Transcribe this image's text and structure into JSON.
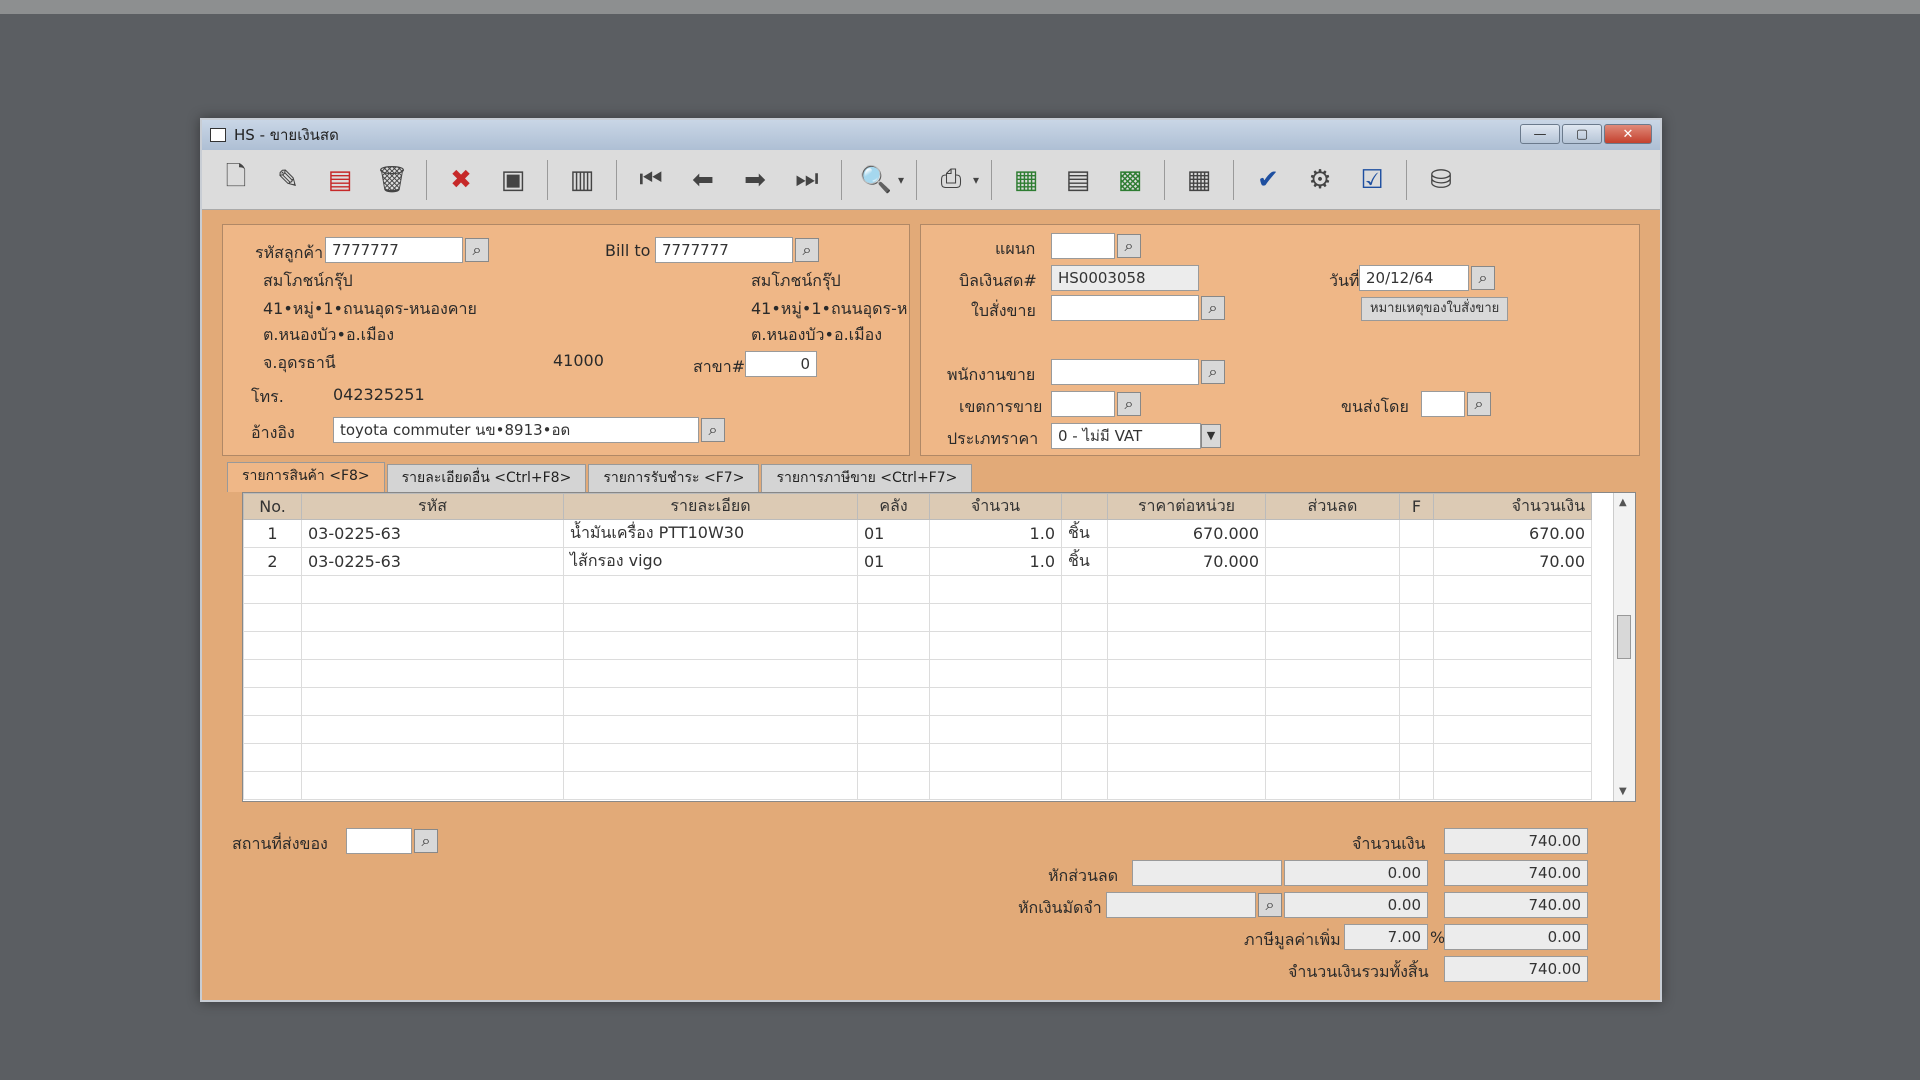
{
  "window": {
    "title": "HS - ขายเงินสด",
    "buttons": [
      "—",
      "▢",
      "✕"
    ]
  },
  "toolbar": {
    "icons": [
      "new-document-icon",
      "edit-icon",
      "print-form-icon",
      "trash-icon",
      "cancel-icon",
      "save-icon",
      "books-icon",
      "first-record-icon",
      "previous-icon",
      "next-icon",
      "last-record-icon",
      "search-doc-icon",
      "printer-icon",
      "report1-icon",
      "report2-icon",
      "report3-icon",
      "calendar-icon",
      "approve-icon",
      "tools-icon",
      "ok-icon",
      "network-icon"
    ]
  },
  "customer": {
    "code_label": "รหัสลูกค้า",
    "code": "7777777",
    "bill_to_label": "Bill to",
    "bill_to": "7777777",
    "name": "สมโภชน์กรุ๊ป",
    "address1": "41•หมู่•1•ถนนอุดร-หนองคาย",
    "address2": "ต.หนองบัว•อ.เมือง",
    "province": "จ.อุดรธานี",
    "postcode": "41000",
    "bill_name": "สมโภชน์กรุ๊ป",
    "bill_address1": "41•หมู่•1•ถนนอุดร-ห",
    "bill_address2": "ต.หนองบัว•อ.เมือง",
    "branch_label": "สาขา#",
    "branch": "0",
    "phone_label": "โทร.",
    "phone": "042325251",
    "ref_label": "อ้างอิง",
    "ref": "toyota commuter นข•8913•อด"
  },
  "document": {
    "dept_label": "แผนก",
    "dept": "",
    "bill_no_label": "บิลเงินสด#",
    "bill_no": "HS0003058",
    "date_label": "วันที่",
    "date": "20/12/64",
    "order_label": "ใบสั่งขาย",
    "order": "",
    "order_note_button": "หมายเหตุของใบสั่งขาย",
    "salesman_label": "พนักงานขาย",
    "salesman": "",
    "zone_label": "เขตการขาย",
    "zone": "",
    "shipby_label": "ขนส่งโดย",
    "shipby": "",
    "price_type_label": "ประเภทราคา",
    "price_type": "0 - ไม่มี VAT"
  },
  "tabs": [
    "รายการสินค้า <F8>",
    "รายละเอียดอื่น <Ctrl+F8>",
    "รายการรับชำระ <F7>",
    "รายการภาษีขาย <Ctrl+F7>"
  ],
  "grid": {
    "headers": [
      "No.",
      "รหัส",
      "รายละเอียด",
      "คลัง",
      "จำนวน",
      "ราคาต่อหน่วย",
      "ส่วนลด",
      "F",
      "จำนวนเงิน"
    ],
    "rows": [
      {
        "no": "1",
        "code": "03-0225-63",
        "desc": "น้ำมันเครื่อง PTT10W30",
        "wh": "01",
        "qty": "1.0",
        "unit": "ชิ้น",
        "price": "670.000",
        "disc": "",
        "f": "",
        "amount": "670.00"
      },
      {
        "no": "2",
        "code": "03-0225-63",
        "desc": "ไส้กรอง vigo",
        "wh": "01",
        "qty": "1.0",
        "unit": "ชิ้น",
        "price": "70.000",
        "disc": "",
        "f": "",
        "amount": "70.00"
      }
    ]
  },
  "footer": {
    "ship_to_label": "สถานที่ส่งของ",
    "ship_to": "",
    "amount_label": "จำนวนเงิน",
    "amount": "740.00",
    "discount_label": "หักส่วนลด",
    "discount": "",
    "discount_value": "0.00",
    "after_discount": "740.00",
    "deposit_label": "หักเงินมัดจำ",
    "deposit": "",
    "deposit_value": "0.00",
    "after_deposit": "740.00",
    "vat_label": "ภาษีมูลค่าเพิ่ม",
    "vat_rate": "7.00",
    "vat_pct": "%",
    "vat_amount": "0.00",
    "total_label": "จำนวนเงินรวมทั้งสิ้น",
    "total": "740.00"
  }
}
